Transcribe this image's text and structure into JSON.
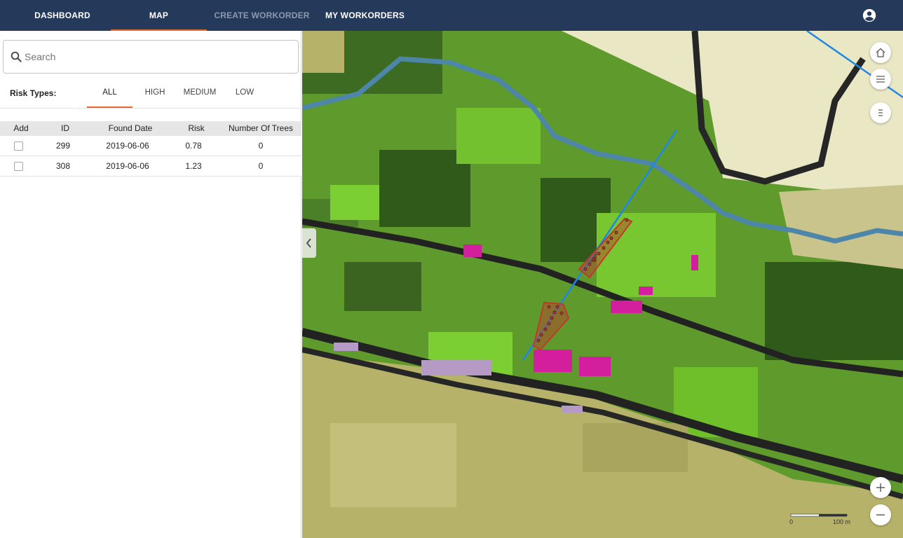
{
  "nav": {
    "tabs": [
      {
        "label": "DASHBOARD"
      },
      {
        "label": "MAP"
      },
      {
        "label": "CREATE WORKORDER"
      },
      {
        "label": "MY WORKORDERS"
      }
    ],
    "active_tab": "MAP",
    "user_icon": "account-circle-icon"
  },
  "search": {
    "placeholder": "Search",
    "value": ""
  },
  "risk_filter": {
    "label": "Risk Types:",
    "tabs": [
      "ALL",
      "HIGH",
      "MEDIUM",
      "LOW"
    ],
    "active": "ALL"
  },
  "table": {
    "columns": [
      "Add",
      "ID",
      "Found Date",
      "Risk",
      "Number Of Trees"
    ],
    "rows": [
      {
        "checked": false,
        "id": "299",
        "found_date": "2019-06-06",
        "risk": "0.78",
        "trees": "0"
      },
      {
        "checked": false,
        "id": "308",
        "found_date": "2019-06-06",
        "risk": "1.23",
        "trees": "0"
      }
    ]
  },
  "map": {
    "controls": [
      "home-icon",
      "layers-list-icon",
      "legend-list-icon",
      "zoom-in-icon",
      "zoom-out-icon"
    ],
    "scale": {
      "start_label": "0",
      "end_label": "100 m"
    },
    "colors": {
      "accent": "#e8692f",
      "header": "#25395b",
      "powerline": "#1e88e5",
      "risk_zone": "#c0392b"
    }
  }
}
